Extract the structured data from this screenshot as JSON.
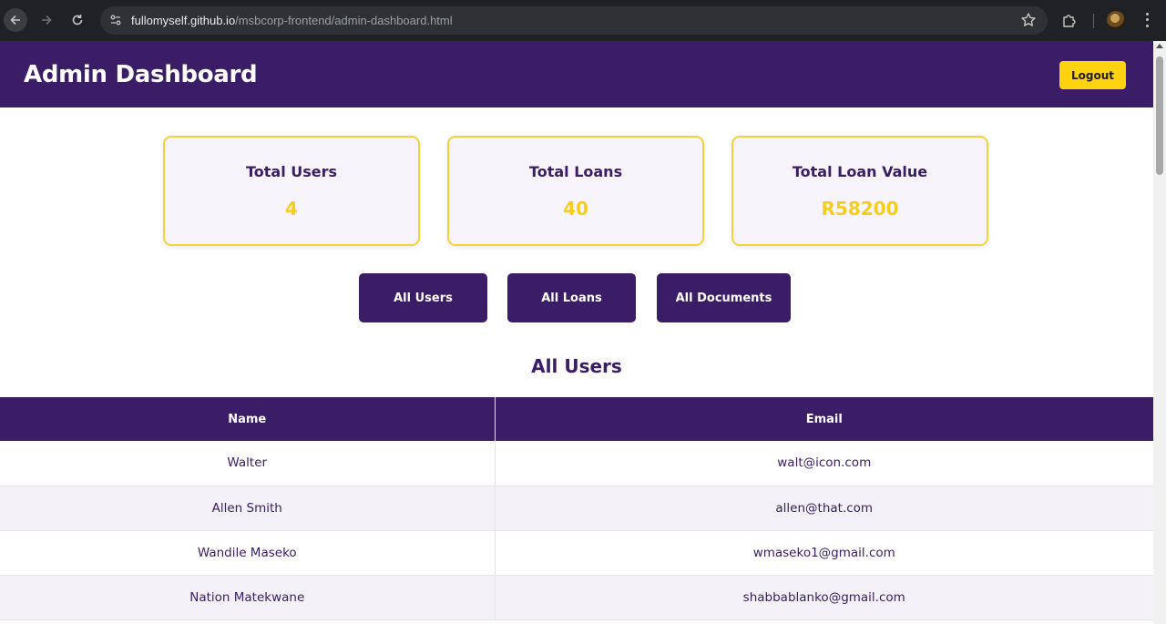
{
  "browser": {
    "url_host": "fullomyself.github.io",
    "url_path": "/msbcorp-frontend/admin-dashboard.html"
  },
  "header": {
    "title": "Admin Dashboard",
    "logout_label": "Logout"
  },
  "stats": [
    {
      "label": "Total Users",
      "value": "4"
    },
    {
      "label": "Total Loans",
      "value": "40"
    },
    {
      "label": "Total Loan Value",
      "value": "R58200"
    }
  ],
  "tabs": [
    {
      "label": "All Users"
    },
    {
      "label": "All Loans"
    },
    {
      "label": "All Documents"
    }
  ],
  "section_title": "All Users",
  "table": {
    "columns": [
      "Name",
      "Email"
    ],
    "rows": [
      {
        "name": "Walter",
        "email": "walt@icon.com"
      },
      {
        "name": "Allen Smith",
        "email": "allen@that.com"
      },
      {
        "name": "Wandile Maseko",
        "email": "wmaseko1@gmail.com"
      },
      {
        "name": "Nation Matekwane",
        "email": "shabbablanko@gmail.com"
      }
    ]
  },
  "colors": {
    "brand_purple": "#3b1c67",
    "accent_yellow": "#fdd20e"
  }
}
